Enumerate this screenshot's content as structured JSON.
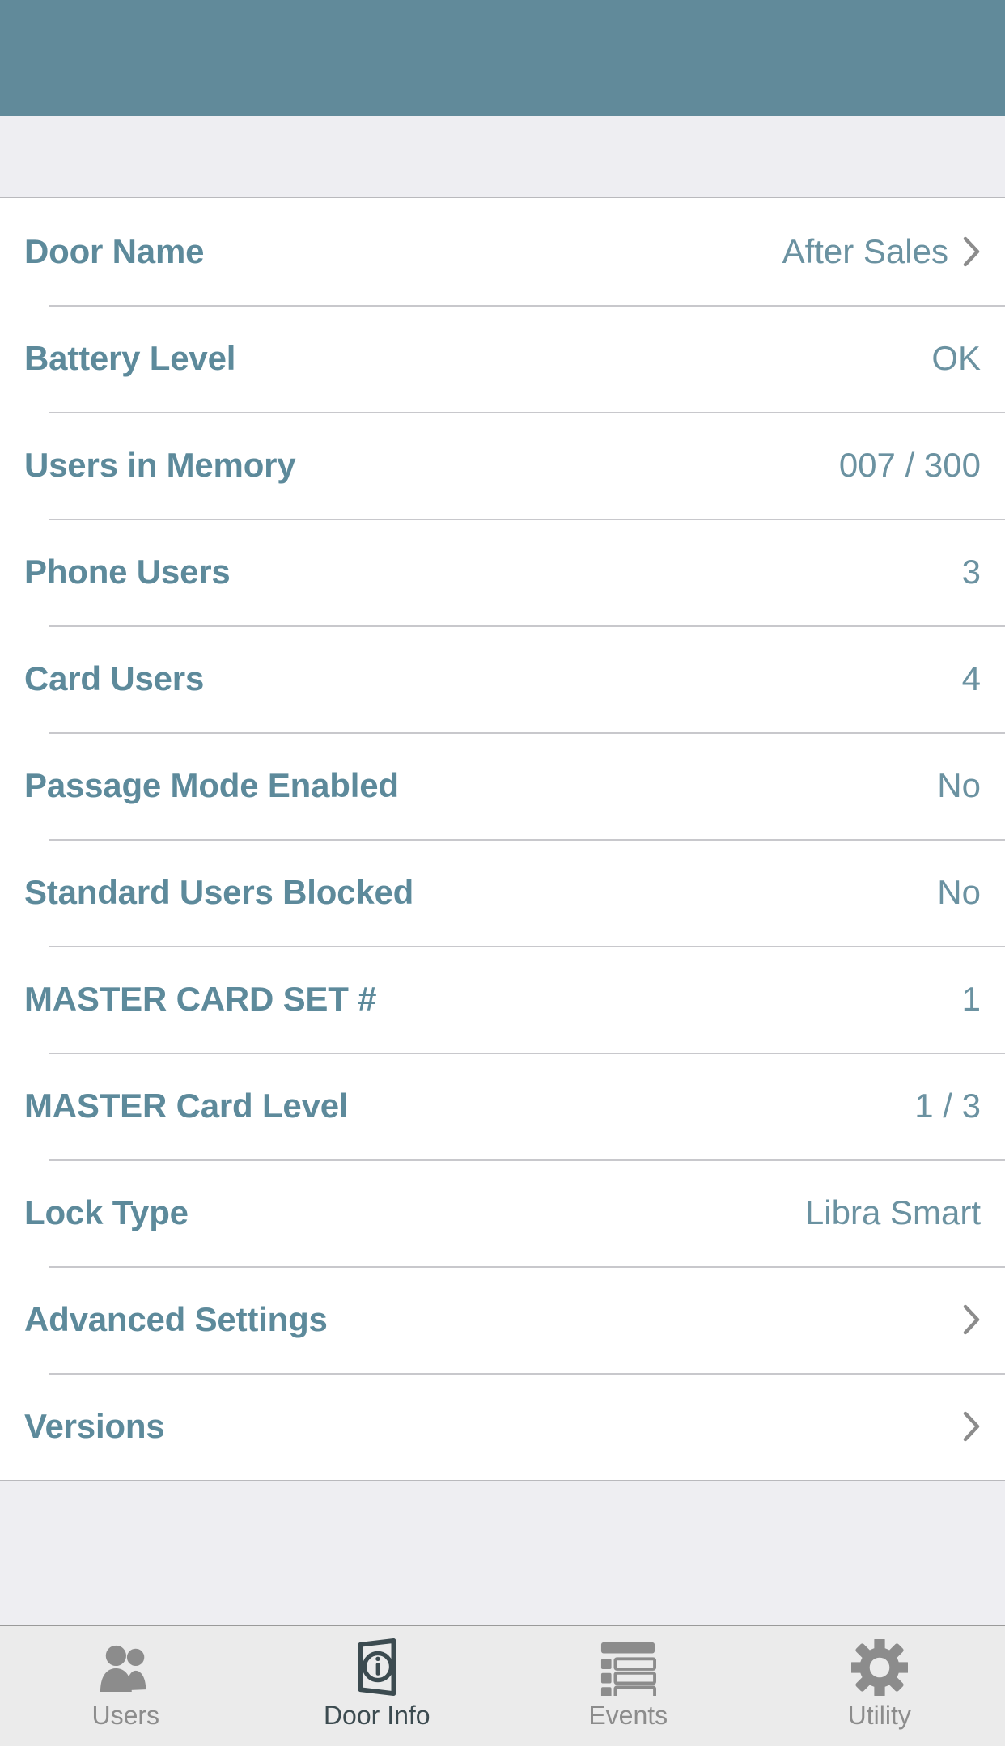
{
  "header": {
    "bar_color": "#618a9a"
  },
  "door_info": {
    "rows": [
      {
        "label": "Door Name",
        "value": "After Sales",
        "chevron": true,
        "icon": "chevron-right-icon"
      },
      {
        "label": "Battery Level",
        "value": "OK",
        "chevron": false,
        "icon": ""
      },
      {
        "label": "Users in Memory",
        "value": "007 / 300",
        "chevron": false,
        "icon": ""
      },
      {
        "label": "Phone Users",
        "value": "3",
        "chevron": false,
        "icon": ""
      },
      {
        "label": "Card Users",
        "value": "4",
        "chevron": false,
        "icon": ""
      },
      {
        "label": "Passage Mode Enabled",
        "value": "No",
        "chevron": false,
        "icon": ""
      },
      {
        "label": "Standard Users Blocked",
        "value": "No",
        "chevron": false,
        "icon": ""
      },
      {
        "label": "MASTER CARD SET #",
        "value": "1",
        "chevron": false,
        "icon": ""
      },
      {
        "label": "MASTER Card Level",
        "value": "1 / 3",
        "chevron": false,
        "icon": ""
      },
      {
        "label": "Lock Type",
        "value": "Libra Smart",
        "chevron": false,
        "icon": ""
      },
      {
        "label": "Advanced Settings",
        "value": "",
        "chevron": true,
        "icon": "chevron-right-icon"
      },
      {
        "label": "Versions",
        "value": "",
        "chevron": true,
        "icon": "chevron-right-icon"
      }
    ]
  },
  "tab_bar": {
    "active_index": 1,
    "tabs": [
      {
        "label": "Users",
        "icon": "users-icon",
        "active": false
      },
      {
        "label": "Door Info",
        "icon": "door-info-icon",
        "active": true
      },
      {
        "label": "Events",
        "icon": "events-list-icon",
        "active": false
      },
      {
        "label": "Utility",
        "icon": "gear-icon",
        "active": false
      }
    ]
  },
  "colors": {
    "header_teal": "#618a9a",
    "label_teal": "#5d8a9b",
    "value_teal": "#6b92a1",
    "separator": "#c8c8cc",
    "spacer_gray": "#eeeef2",
    "tabbar_gray": "#ebebeb",
    "tab_inactive": "#8c8c8c",
    "tab_active": "#3c4b50",
    "chevron_gray": "#8c8c8c"
  }
}
